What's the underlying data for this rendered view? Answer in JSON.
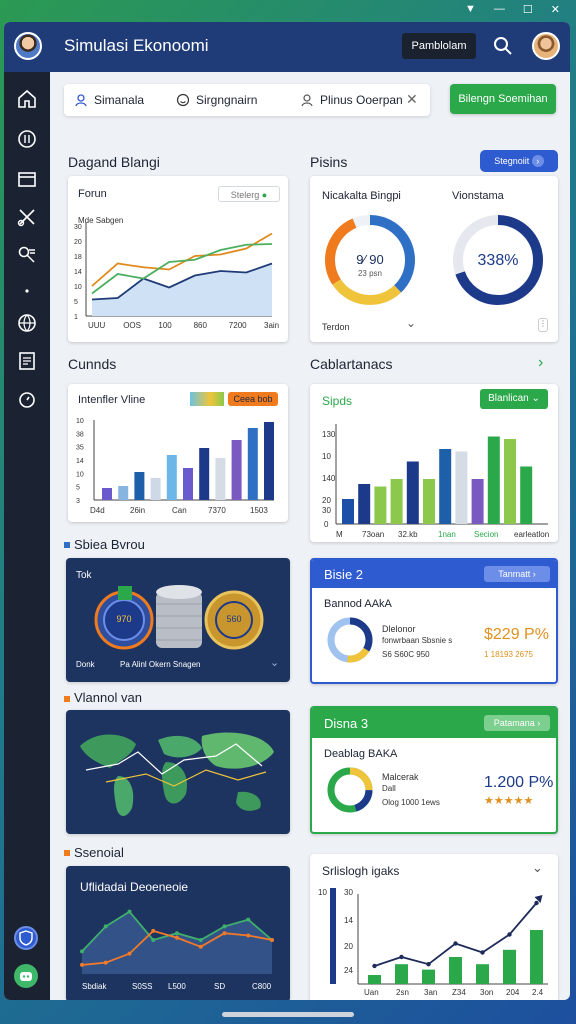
{
  "app": {
    "title": "Simulasi Ekonoomi",
    "top_button": "Pamblolam"
  },
  "filters": [
    {
      "label": "Simanala",
      "icon": "user-icon"
    },
    {
      "label": "Sirgngnairn",
      "icon": "smile-icon"
    },
    {
      "label": "Plinus Ooerpan",
      "icon": "person-icon"
    }
  ],
  "primary_button": "Bilengn Soemihan",
  "sidebar": {
    "icons": [
      "home-icon",
      "coin-icon",
      "store-icon",
      "scissors-icon",
      "search-people-icon",
      "dot-icon",
      "globe-icon",
      "document-icon",
      "timer-icon"
    ]
  },
  "sections": {
    "left1": "Dagand Blangi",
    "right1": "Pisins",
    "right1_button": "Stegnoiit",
    "left2": "Cunnds",
    "right2": "Cablartanacs",
    "left3": "Sbiea Bvrou",
    "left4": "Vlannol van",
    "left5": "Ssenoial"
  },
  "card_line": {
    "title": "Forun",
    "pill": "Stelerg",
    "ylabel": "Mde Sabgen"
  },
  "card_donuts": {
    "title_left": "Nicakalta Bingpi",
    "title_right": "Vionstama",
    "donut_left_value": "9⁄ 90",
    "donut_left_sub": "23 psn",
    "donut_right_value": "338%",
    "footer": "Terdon"
  },
  "card_bars_left": {
    "title": "Intenfler Vline",
    "pill": "Ceea bob",
    "xlabels": [
      "D4d",
      "26in",
      "Can",
      "7370",
      "1503"
    ]
  },
  "card_bars_right": {
    "title": "Sipds",
    "button": "Blanlican",
    "yticks": [
      "130",
      "10",
      "140",
      "20",
      "30",
      "0"
    ],
    "xlabels": [
      "M",
      "73oan",
      "32.kb",
      "1nan",
      "Secion",
      "earleatlon"
    ]
  },
  "card_coins": {
    "label": "Tok",
    "coin1": "970",
    "coin2": "560",
    "footer_left": "Donk",
    "footer_right": "Pa Alinl Okern Snagen"
  },
  "card_bisie2": {
    "header": "Bisie 2",
    "header_btn": "Tanmatt",
    "subtitle": "Bannod AAkA",
    "line1": "Dlelonor",
    "line2": "fonwrbaan Sbsnie s",
    "line3": "S6 S60C 950",
    "value": "$229 P%",
    "subvalue": "1 18193 2675"
  },
  "card_disna3": {
    "header": "Disna 3",
    "header_btn": "Patamana",
    "subtitle": "Deablag BAKA",
    "line1": "Malcerak",
    "line2": "Dall",
    "line3": "Olog 1000 1ews",
    "value": "1.200 P%",
    "stars": "★★★★★"
  },
  "card_economic": {
    "title": "Uflidadai Deoeneoie",
    "xlabels": [
      "Sbdiak",
      "S0SS",
      "L500",
      "SD",
      "C800"
    ]
  },
  "card_growth": {
    "title": "Srlislogh igaks",
    "yticks": [
      "10",
      "30",
      "14",
      "20",
      "24"
    ],
    "xlabels": [
      "Uan",
      "2sn",
      "3an",
      "Z34",
      "3on",
      "204",
      "2.4"
    ]
  },
  "chart_data": [
    {
      "type": "line",
      "name": "forun-line",
      "x": [
        "UUU",
        "OOS",
        "100",
        "860",
        "7200",
        "3ain"
      ],
      "series": [
        {
          "color": "#1f3c78",
          "values": [
            22,
            24,
            50,
            38,
            54,
            60,
            58,
            70
          ]
        },
        {
          "color": "#e08a1e",
          "values": [
            40,
            70,
            65,
            62,
            80,
            82,
            90,
            110
          ]
        },
        {
          "color": "#4caf60",
          "values": [
            30,
            56,
            50,
            72,
            75,
            88,
            95,
            96
          ]
        }
      ],
      "yticks": [
        "30",
        "20",
        "18",
        "14",
        "10",
        "5",
        "1"
      ]
    },
    {
      "type": "bar",
      "name": "intenfler-bars",
      "values": [
        12,
        14,
        28,
        22,
        45,
        32,
        52,
        42,
        60,
        72,
        78
      ],
      "colors": [
        "#6a5acd",
        "#87b5e0",
        "#1d5fa8",
        "#cfd8e6",
        "#6cb6e8",
        "#6a5acd",
        "#1d3a8a",
        "#d6dce6",
        "#7a5ac0",
        "#2f6fc4",
        "#1d3a8a"
      ],
      "yticks": [
        "10",
        "38",
        "35",
        "14",
        "10",
        "5",
        "3"
      ]
    },
    {
      "type": "bar",
      "name": "sipds-bars",
      "values": [
        20,
        32,
        30,
        36,
        50,
        36,
        60,
        58,
        36,
        70,
        68,
        46
      ],
      "colors": [
        "#1d4fa8",
        "#1d3a8a",
        "#8cc84b",
        "#8cc84b",
        "#1d3a8a",
        "#8cc84b",
        "#1d5fa8",
        "#d6dce6",
        "#7a5ac0",
        "#2aa84a",
        "#8cc84b",
        "#2aa84a"
      ],
      "ymax": 80
    },
    {
      "type": "line",
      "name": "economic-area",
      "series": [
        {
          "color": "#3fb06b",
          "values": [
            20,
            42,
            55,
            30,
            36,
            30,
            42,
            48,
            30
          ]
        },
        {
          "color": "#f07a2a",
          "values": [
            8,
            10,
            18,
            38,
            32,
            24,
            36,
            34,
            30
          ]
        }
      ]
    },
    {
      "type": "bar",
      "name": "growth-bars",
      "values": [
        10,
        22,
        16,
        30,
        22,
        38,
        60
      ],
      "line": [
        20,
        30,
        22,
        45,
        35,
        55,
        90
      ]
    }
  ]
}
